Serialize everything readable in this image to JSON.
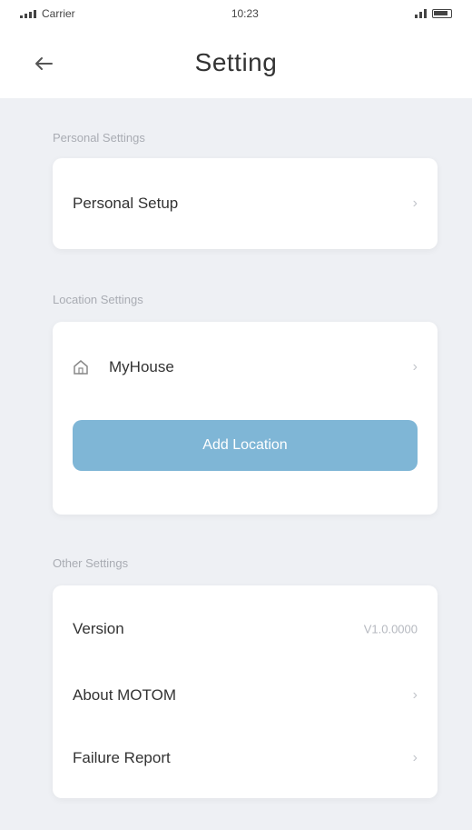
{
  "status_bar": {
    "carrier": "Carrier",
    "time": "10:23"
  },
  "header": {
    "title": "Setting",
    "back_icon": "arrow-left-icon"
  },
  "sections": {
    "personal": {
      "label": "Personal Settings",
      "items": [
        {
          "label": "Personal Setup",
          "icon": "chevron-right-icon"
        }
      ]
    },
    "location": {
      "label": "Location Settings",
      "home_name": "MyHouse",
      "home_icon": "house-icon",
      "add_button_label": "Add Location"
    },
    "other": {
      "label": "Other Settings",
      "version_label": "Version",
      "version_value": "V1.0.0000",
      "about_label": "About MOTOM",
      "failure_label": "Failure Report"
    }
  },
  "colors": {
    "accent": "#7fb6d6",
    "background": "#eef0f4",
    "card": "#ffffff"
  }
}
